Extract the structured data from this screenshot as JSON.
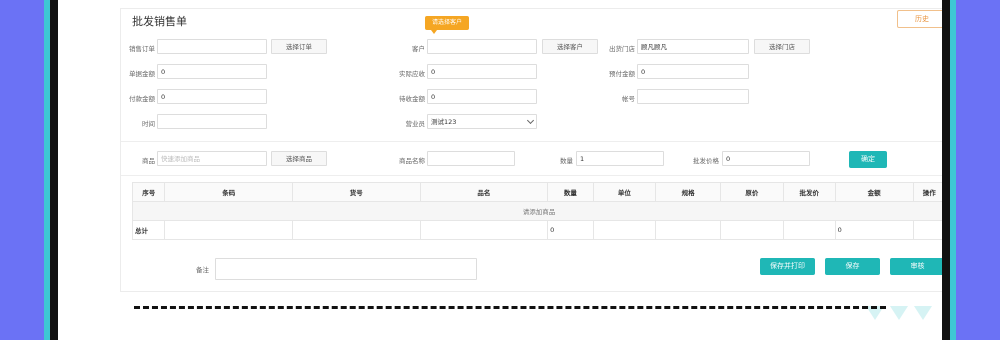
{
  "title": "批发销售单",
  "history_button": "历史",
  "tooltip": "请选择客户",
  "form": {
    "order_label": "销售订单",
    "order_value": "",
    "select_order_button": "选择订单",
    "customer_label": "客户",
    "customer_value": "",
    "select_customer_button": "选择客户",
    "store_label": "出货门店",
    "store_value": "顾凡顾凡",
    "select_store_button": "选择门店",
    "total_amount_label": "单据金额",
    "total_amount_value": "0",
    "actual_received_label": "实际应收",
    "actual_received_value": "0",
    "prepaid_label": "预付金额",
    "prepaid_value": "0",
    "paid_label": "付款金额",
    "paid_value": "0",
    "pending_label": "待收金额",
    "pending_value": "0",
    "account_label": "帐号",
    "account_value": "",
    "time_label": "时间",
    "time_value": "",
    "salesperson_label": "营业员",
    "salesperson_value": "测试123"
  },
  "product_row": {
    "product_label": "商品",
    "product_placeholder": "快速添加商品",
    "select_product_button": "选择商品",
    "name_label": "商品名称",
    "name_value": "",
    "qty_label": "数量",
    "qty_value": "1",
    "price_label": "批发价格",
    "price_value": "0",
    "confirm_button": "确定"
  },
  "table": {
    "columns": [
      "序号",
      "条码",
      "货号",
      "品名",
      "数量",
      "单位",
      "规格",
      "原价",
      "批发价",
      "金额",
      "操作"
    ],
    "empty_text": "请添加商品",
    "total_label": "总计",
    "total_qty": "0",
    "total_amount": "0"
  },
  "remark_label": "备注",
  "remark_value": "",
  "actions": {
    "save_print": "保存并打印",
    "save": "保存",
    "review": "审核"
  },
  "colors": {
    "accent": "#1fb7b6",
    "warning": "#f5a623",
    "background": "#6b72f5"
  }
}
